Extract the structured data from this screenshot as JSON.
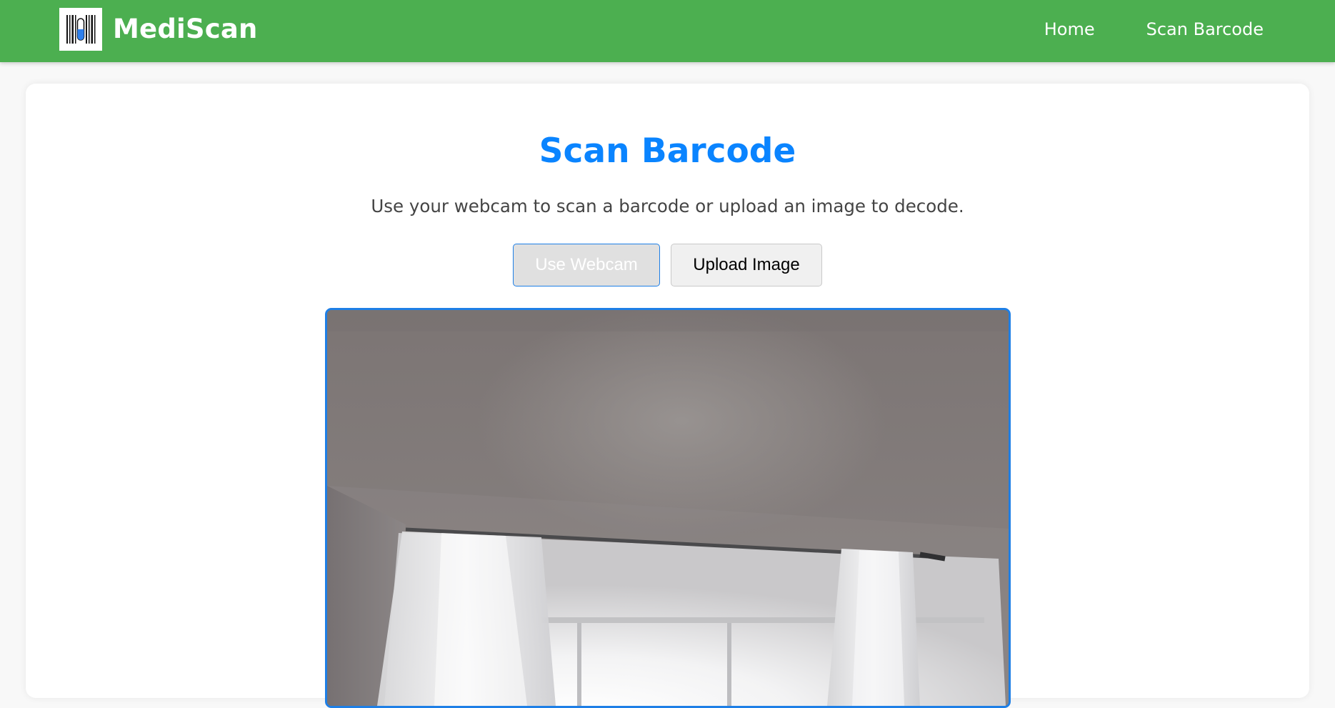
{
  "app": {
    "brand_name": "MediScan",
    "brand_color": "#4caf50",
    "logo_icon": "barcode-pill-icon"
  },
  "nav": {
    "items": [
      {
        "label": "Home"
      },
      {
        "label": "Scan Barcode"
      }
    ]
  },
  "main": {
    "title": "Scan Barcode",
    "title_color": "#0a84ff",
    "subtitle": "Use your webcam to scan a barcode or upload an image to decode."
  },
  "actions": {
    "webcam_label": "Use Webcam",
    "upload_label": "Upload Image",
    "active": "webcam",
    "accent_color": "#1e7fe6"
  }
}
